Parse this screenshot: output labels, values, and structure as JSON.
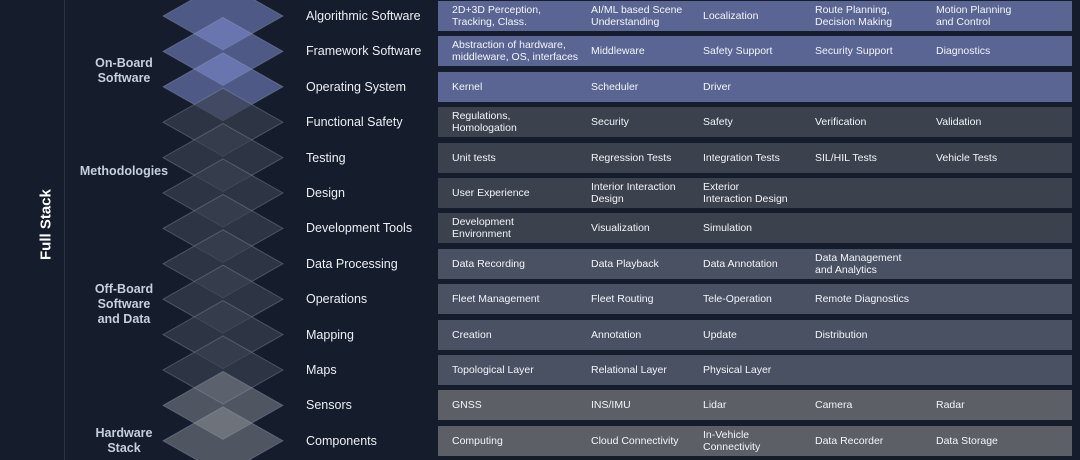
{
  "title": "Full Stack",
  "groups": [
    {
      "key": "onboard",
      "lines": [
        "On-Board",
        "Software"
      ]
    },
    {
      "key": "method",
      "lines": [
        "Methodologies"
      ]
    },
    {
      "key": "offboard",
      "lines": [
        "Off-Board",
        "Software",
        "and Data"
      ]
    },
    {
      "key": "hardware",
      "lines": [
        "Hardware",
        "Stack"
      ]
    }
  ],
  "rows": [
    {
      "group": "onboard",
      "label": "Algorithmic Software",
      "cells": [
        "2D+3D Perception,\nTracking, Class.",
        "AI/ML based Scene\nUnderstanding",
        "Localization",
        "Route Planning,\nDecision Making",
        "Motion Planning\nand Control"
      ]
    },
    {
      "group": "onboard",
      "label": "Framework Software",
      "cells": [
        "Abstraction of hardware,\nmiddleware, OS, interfaces",
        "Middleware",
        "Safety Support",
        "Security Support",
        "Diagnostics"
      ]
    },
    {
      "group": "onboard",
      "label": "Operating System",
      "cells": [
        "Kernel",
        "Scheduler",
        "Driver",
        "",
        ""
      ]
    },
    {
      "group": "method",
      "label": "Functional Safety",
      "cells": [
        "Regulations,\nHomologation",
        "Security",
        "Safety",
        "Verification",
        "Validation"
      ]
    },
    {
      "group": "method",
      "label": "Testing",
      "cells": [
        "Unit tests",
        "Regression Tests",
        "Integration  Tests",
        "SIL/HIL  Tests",
        "Vehicle Tests"
      ]
    },
    {
      "group": "method",
      "label": "Design",
      "cells": [
        "User Experience",
        "Interior Interaction\nDesign",
        "Exterior\nInteraction Design",
        "",
        ""
      ]
    },
    {
      "group": "method",
      "label": "Development Tools",
      "cells": [
        "Development\nEnvironment",
        "Visualization",
        "Simulation",
        "",
        ""
      ]
    },
    {
      "group": "offboard",
      "label": "Data Processing",
      "cells": [
        "Data Recording",
        "Data Playback",
        "Data Annotation",
        "Data Management\nand Analytics",
        ""
      ]
    },
    {
      "group": "offboard",
      "label": "Operations",
      "cells": [
        "Fleet Management",
        "Fleet Routing",
        "Tele-Operation",
        "Remote Diagnostics",
        ""
      ]
    },
    {
      "group": "offboard",
      "label": "Mapping",
      "cells": [
        "Creation",
        "Annotation",
        "Update",
        "Distribution",
        ""
      ]
    },
    {
      "group": "offboard",
      "label": "Maps",
      "cells": [
        "Topological Layer",
        "Relational Layer",
        "Physical Layer",
        "",
        ""
      ]
    },
    {
      "group": "hardware",
      "label": "Sensors",
      "cells": [
        "GNSS",
        "INS/IMU",
        "Lidar",
        "Camera",
        "Radar"
      ]
    },
    {
      "group": "hardware",
      "label": "Components",
      "cells": [
        "Computing",
        "Cloud Connectivity",
        "In-Vehicle\nConnectivity",
        "Data Recorder",
        "Data Storage"
      ]
    }
  ],
  "colors": {
    "background": "#151d2c",
    "onboard": "#5a6594",
    "methodologies": "#3c414e",
    "offboard": "#4a5163",
    "hardware": "#5c5f66",
    "layer_onboard": "#7e8cd0",
    "layer_default": "#3a4152",
    "layer_hardware": "#8c8f96"
  }
}
